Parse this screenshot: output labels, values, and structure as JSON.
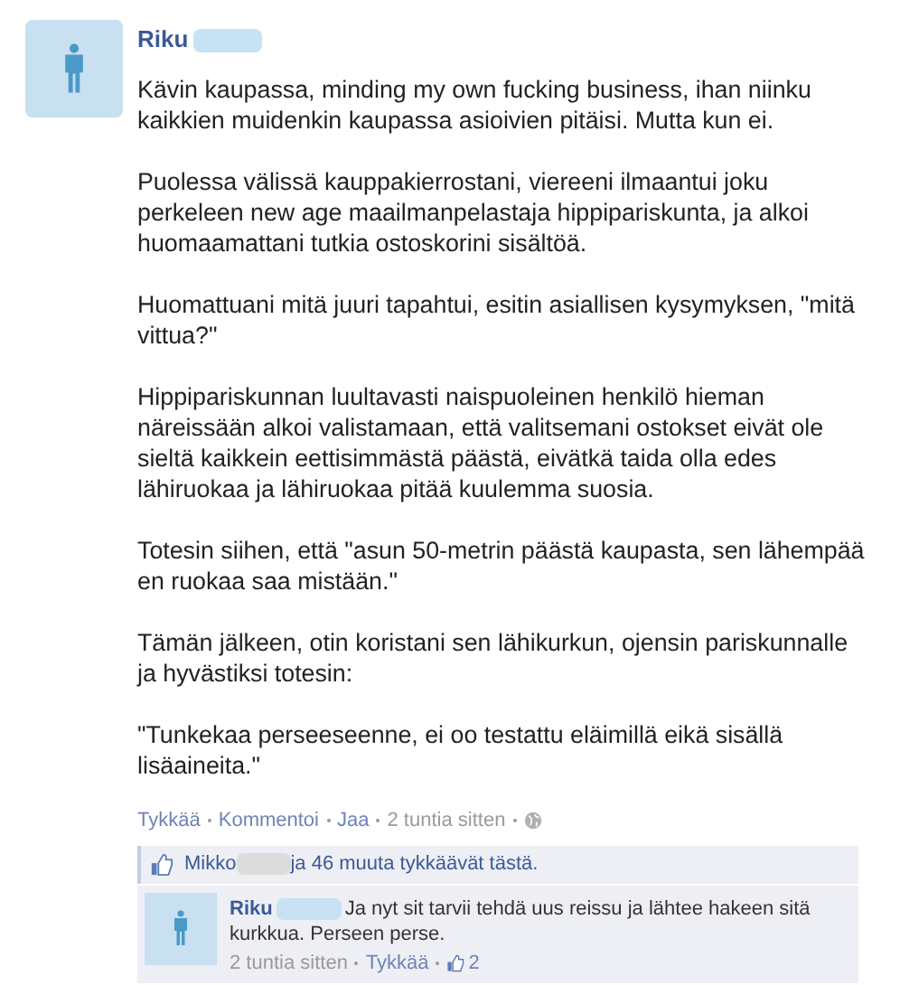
{
  "post": {
    "author": "Riku",
    "paragraphs": [
      "Kävin kaupassa, minding my own fucking business, ihan niinku kaikkien muidenkin kaupassa asioivien pitäisi. Mutta kun ei.",
      "Puolessa välissä kauppakierrostani, viereeni ilmaantui joku perkeleen new age maailmanpelastaja hippipariskunta, ja alkoi huomaamattani tutkia ostoskorini sisältöä.",
      "Huomattuani mitä juuri tapahtui, esitin asiallisen kysymyksen, \"mitä vittua?\"",
      "Hippipariskunnan luultavasti naispuoleinen henkilö hieman näreissään alkoi valistamaan, että valitsemani ostokset eivät ole sieltä kaikkein eettisimmästä päästä, eivätkä taida olla edes lähiruokaa ja lähiruokaa pitää kuulemma suosia.",
      "Totesin siihen, että \"asun 50-metrin päästä kaupasta, sen lähempää en ruokaa saa mistään.\"",
      "Tämän jälkeen, otin koristani sen lähikurkun, ojensin pariskunnalle ja hyvästiksi totesin:",
      "\"Tunkekaa perseeseenne, ei oo testattu eläimillä eikä sisällä lisäaineita.\""
    ],
    "actions": [
      "Tykkää",
      "Kommentoi",
      "Jaa",
      "2 tuntia sitten"
    ]
  },
  "likes": {
    "name": "Mikko",
    "text": "ja 46 muuta tykkäävät tästä."
  },
  "comments": [
    {
      "author": "Riku",
      "text": "Ja nyt sit tarvii tehdä uus reissu ja lähtee hakeen sitä kurkkua. Perseen perse.",
      "time": "2 tuntia sitten",
      "like": "Tykkää",
      "like_count": "2"
    }
  ]
}
